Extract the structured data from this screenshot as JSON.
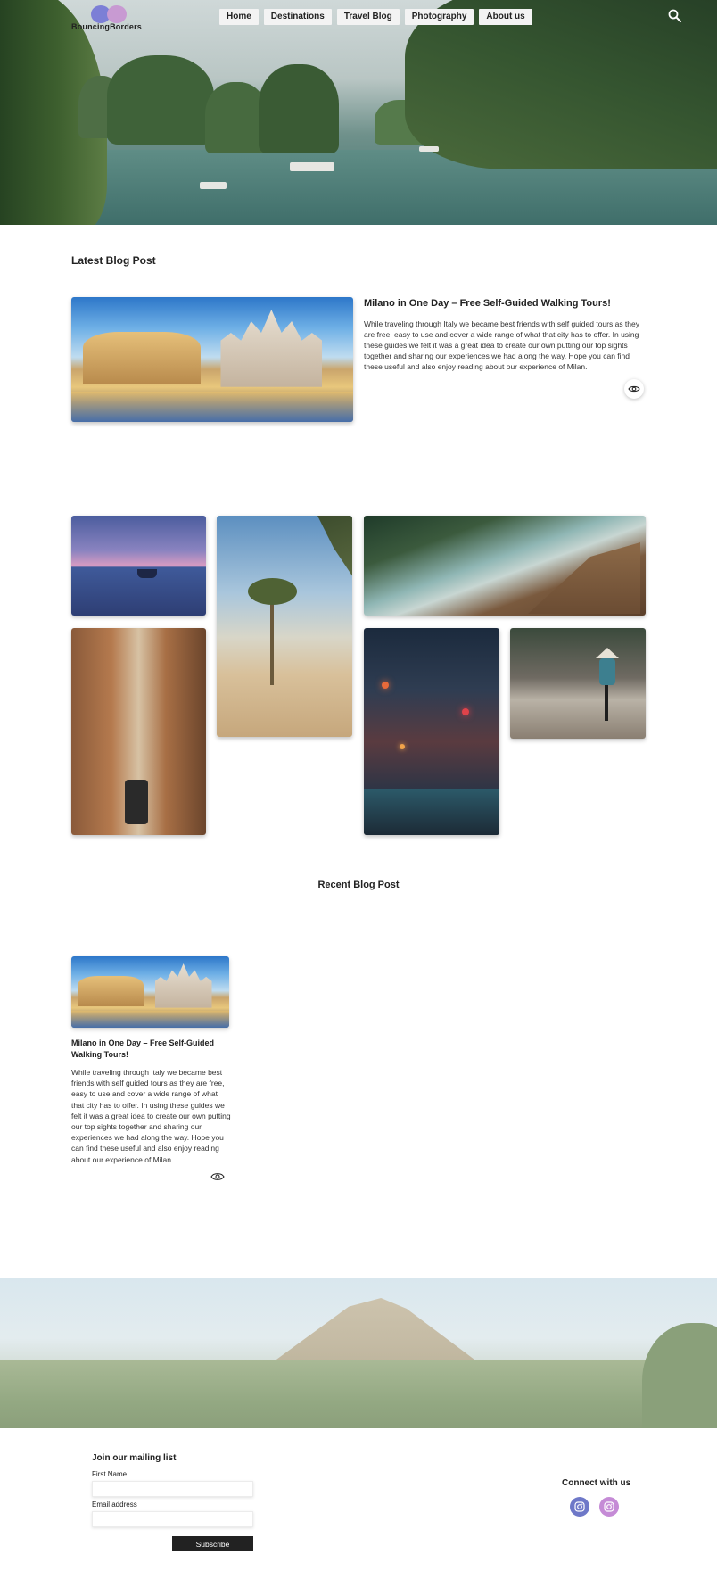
{
  "header": {
    "logo_text": "BouncingBorders",
    "nav": [
      {
        "label": "Home"
      },
      {
        "label": "Destinations"
      },
      {
        "label": "Travel Blog"
      },
      {
        "label": "Photography"
      },
      {
        "label": "About us"
      }
    ],
    "search_icon": "search-icon"
  },
  "latest": {
    "heading": "Latest Blog Post",
    "post": {
      "title": "Milano in One Day – Free Self-Guided Walking Tours!",
      "excerpt": "While traveling through Italy we became best friends with self guided tours as they are free, easy to use and cover a wide range of what that city has to offer. In using these guides we felt it was a great idea to create our own putting our top sights together and sharing our experiences we had along the way. Hope you can find these useful and also enjoy reading about our experience of Milan.",
      "view_icon": "eye-icon"
    }
  },
  "recent": {
    "heading": "Recent Blog Post",
    "posts": [
      {
        "title": "Milano in One Day – Free Self-Guided Walking Tours!",
        "excerpt": "While traveling through Italy we became best friends with self guided tours as they are free, easy to use and cover a wide range of what that city has to offer. In using these guides we felt it was a great idea to create our own putting our top sights together and sharing our experiences we had along the way. Hope you can find these useful and also enjoy reading about our experience of Milan.",
        "view_icon": "eye-icon"
      }
    ]
  },
  "footer": {
    "mailing_title": "Join our mailing list",
    "first_name_label": "First Name",
    "first_name_value": "",
    "email_label": "Email address",
    "email_value": "",
    "subscribe_label": "Subscribe",
    "connect_title": "Connect with us",
    "socials": [
      {
        "icon": "instagram-icon",
        "color": "#6e78c8"
      },
      {
        "icon": "instagram-icon",
        "color": "#c58bd6"
      }
    ]
  }
}
